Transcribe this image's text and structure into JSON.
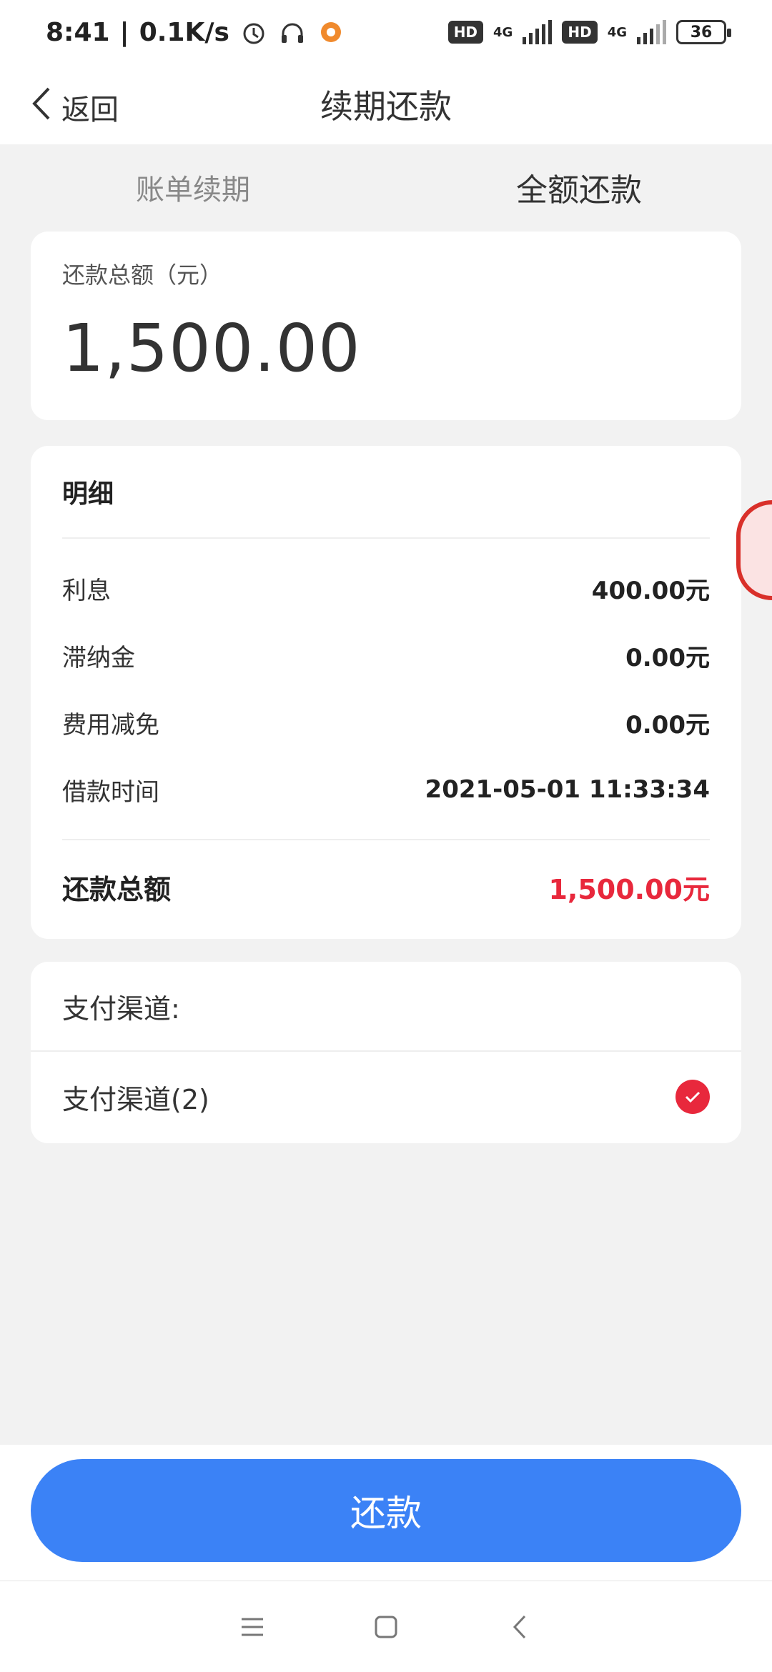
{
  "status_bar": {
    "time": "8:41",
    "net_speed": "0.1K/s",
    "sim1_badge": "HD",
    "sim1_type": "4G",
    "sim2_badge": "HD",
    "sim2_type": "4G",
    "battery": "36"
  },
  "header": {
    "back_label": "返回",
    "title": "续期还款"
  },
  "tabs": [
    {
      "label": "账单续期",
      "active": false
    },
    {
      "label": "全额还款",
      "active": true
    }
  ],
  "total_card": {
    "label": "还款总额（元）",
    "amount": "1,500.00"
  },
  "detail": {
    "title": "明细",
    "rows": [
      {
        "key": "利息",
        "value": "400.00元"
      },
      {
        "key": "滞纳金",
        "value": "0.00元"
      },
      {
        "key": "费用减免",
        "value": "0.00元"
      },
      {
        "key": "借款时间",
        "value": "2021-05-01 11:33:34"
      }
    ],
    "total_key": "还款总额",
    "total_value": "1,500.00元"
  },
  "payment": {
    "header": "支付渠道:",
    "option": "支付渠道(2)",
    "selected": true
  },
  "submit_label": "还款",
  "colors": {
    "accent_blue": "#3b82f6",
    "red": "#e8283c",
    "background": "#f2f2f2"
  }
}
